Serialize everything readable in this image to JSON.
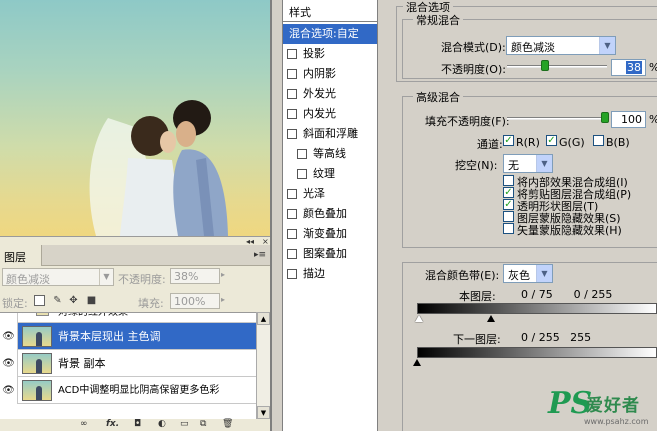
{
  "layers_panel": {
    "tab_label": "图层",
    "blend_mode": "颜色减淡",
    "opacity_label": "不透明度:",
    "opacity_value": "38%",
    "lock_label": "锁定:",
    "fill_label": "填充:",
    "fill_value": "100%",
    "layers": [
      {
        "name": "对绿的红外效果",
        "selected": false
      },
      {
        "name": "背景本层现出 主色调",
        "selected": true
      },
      {
        "name": "背景 副本",
        "selected": false
      },
      {
        "name": "ACD中调整明显比阴高保留更多色彩",
        "selected": false
      }
    ]
  },
  "dialog": {
    "styles_header": "样式",
    "styles": [
      {
        "label": "混合选项:自定",
        "checkbox": false,
        "selected": true,
        "indent": false
      },
      {
        "label": "投影",
        "checkbox": true,
        "selected": false,
        "indent": false
      },
      {
        "label": "内阴影",
        "checkbox": true,
        "selected": false,
        "indent": false
      },
      {
        "label": "外发光",
        "checkbox": true,
        "selected": false,
        "indent": false
      },
      {
        "label": "内发光",
        "checkbox": true,
        "selected": false,
        "indent": false
      },
      {
        "label": "斜面和浮雕",
        "checkbox": true,
        "selected": false,
        "indent": false
      },
      {
        "label": "等高线",
        "checkbox": true,
        "selected": false,
        "indent": true
      },
      {
        "label": "纹理",
        "checkbox": true,
        "selected": false,
        "indent": true
      },
      {
        "label": "光泽",
        "checkbox": true,
        "selected": false,
        "indent": false
      },
      {
        "label": "颜色叠加",
        "checkbox": true,
        "selected": false,
        "indent": false
      },
      {
        "label": "渐变叠加",
        "checkbox": true,
        "selected": false,
        "indent": false
      },
      {
        "label": "图案叠加",
        "checkbox": true,
        "selected": false,
        "indent": false
      },
      {
        "label": "描边",
        "checkbox": true,
        "selected": false,
        "indent": false
      }
    ],
    "blend_options_title": "混合选项",
    "general_title": "常规混合",
    "blend_mode_label": "混合模式(D):",
    "blend_mode_value": "颜色减淡",
    "opacity_label": "不透明度(O):",
    "opacity_value": "38",
    "opacity_level": 0.38,
    "pct": "%",
    "advanced_title": "高级混合",
    "fill_label": "填充不透明度(F):",
    "fill_value": "100",
    "fill_level": 1.0,
    "channels_label": "通道:",
    "channels": [
      {
        "label": "R(R)",
        "checked": true
      },
      {
        "label": "G(G)",
        "checked": true
      },
      {
        "label": "B(B)",
        "checked": false
      }
    ],
    "knockout_label": "挖空(N):",
    "knockout_value": "无",
    "options": [
      {
        "label": "将内部效果混合成组(I)",
        "checked": false
      },
      {
        "label": "将剪贴图层混合成组(P)",
        "checked": true
      },
      {
        "label": "透明形状图层(T)",
        "checked": true
      },
      {
        "label": "图层蒙版隐藏效果(S)",
        "checked": false
      },
      {
        "label": "矢量蒙版隐藏效果(H)",
        "checked": false
      }
    ],
    "blend_if_label": "混合颜色带(E):",
    "blend_if_value": "灰色",
    "this_layer_label": "本图层:",
    "this_layer_values": "0 / 75      0 / 255",
    "underlying_label": "下一图层:",
    "underlying_values": "0 / 255   255"
  },
  "watermark": {
    "logo": "PS",
    "title": "爱好者",
    "url": "www.psahz.com"
  }
}
